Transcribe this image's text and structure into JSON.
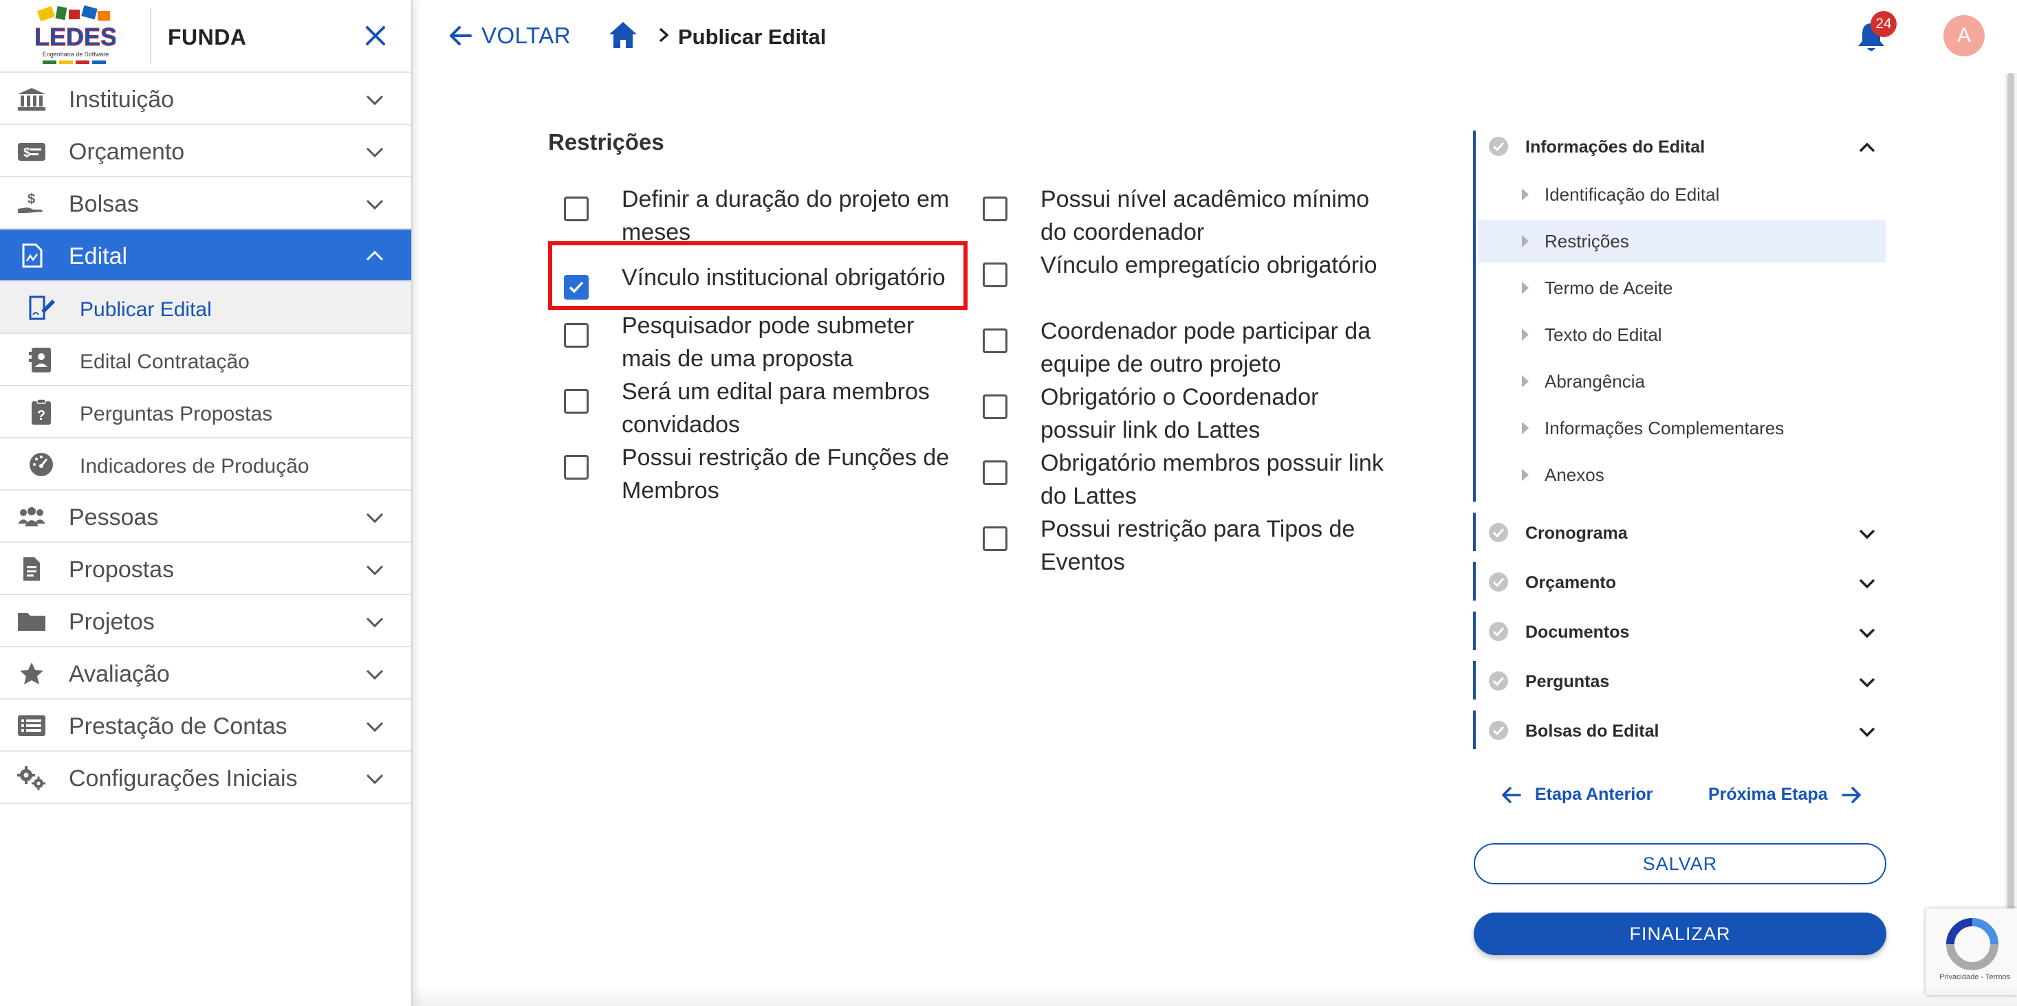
{
  "sidebar": {
    "app_name": "FUNDA",
    "logo_alt": "LEDES Engenharia de Software",
    "items": [
      {
        "label": "Instituição",
        "icon": "institution-icon",
        "expanded": false
      },
      {
        "label": "Orçamento",
        "icon": "money-icon",
        "expanded": false
      },
      {
        "label": "Bolsas",
        "icon": "hand-money-icon",
        "expanded": false
      },
      {
        "label": "Edital",
        "icon": "document-icon",
        "expanded": true
      },
      {
        "label": "Pessoas",
        "icon": "people-icon",
        "expanded": false
      },
      {
        "label": "Propostas",
        "icon": "file-icon",
        "expanded": false
      },
      {
        "label": "Projetos",
        "icon": "folder-icon",
        "expanded": false
      },
      {
        "label": "Avaliação",
        "icon": "star-icon",
        "expanded": false
      },
      {
        "label": "Prestação de Contas",
        "icon": "list-icon",
        "expanded": false
      },
      {
        "label": "Configurações Iniciais",
        "icon": "gears-icon",
        "expanded": false
      }
    ],
    "edital_subitems": [
      {
        "label": "Publicar Edital",
        "icon": "sign-document-icon",
        "selected": true
      },
      {
        "label": "Edital Contratação",
        "icon": "contact-card-icon",
        "selected": false
      },
      {
        "label": "Perguntas Propostas",
        "icon": "clipboard-question-icon",
        "selected": false
      },
      {
        "label": "Indicadores de Produção",
        "icon": "gauge-icon",
        "selected": false
      }
    ]
  },
  "topbar": {
    "back_label": "VOLTAR",
    "breadcrumb_current": "Publicar Edital",
    "notifications_count": "24",
    "avatar_initial": "A"
  },
  "main": {
    "section_title": "Restrições",
    "col1": [
      {
        "label": "Definir a duração do projeto em meses",
        "checked": false
      },
      {
        "label": "Vínculo institucional obrigatório",
        "checked": true
      },
      {
        "label": "Pesquisador pode submeter mais de uma proposta",
        "checked": false
      },
      {
        "label": "Será um edital para membros convidados",
        "checked": false
      },
      {
        "label": "Possui restrição de Funções de Membros",
        "checked": false
      }
    ],
    "col2": [
      {
        "label": "Possui nível acadêmico mínimo do coordenador",
        "checked": false
      },
      {
        "label": "Vínculo empregatício obrigatório",
        "checked": false
      },
      {
        "label": "Coordenador pode participar da equipe de outro projeto",
        "checked": false
      },
      {
        "label": "Obrigatório o Coordenador possuir link do Lattes",
        "checked": false
      },
      {
        "label": "Obrigatório membros possuir link do Lattes",
        "checked": false
      },
      {
        "label": "Possui restrição para Tipos de Eventos",
        "checked": false
      }
    ]
  },
  "stepper": {
    "first_step": {
      "label": "Informações do Edital",
      "expanded": true,
      "substeps": [
        "Identificação do Edital",
        "Restrições",
        "Termo de Aceite",
        "Texto do Edital",
        "Abrangência",
        "Informações Complementares",
        "Anexos"
      ],
      "current_substep": "Restrições"
    },
    "other_steps": [
      "Cronograma",
      "Orçamento",
      "Documentos",
      "Perguntas",
      "Bolsas do Edital"
    ],
    "prev_label": "Etapa Anterior",
    "next_label": "Próxima Etapa",
    "save_label": "SALVAR",
    "finish_label": "FINALIZAR"
  },
  "recaptcha": {
    "text": "Privacidade - Termos"
  },
  "colors": {
    "primary": "#1553b6",
    "active_menu": "#2a6fd8",
    "highlight": "#e81515",
    "badge": "#d32f2f",
    "avatar": "#f4a79b"
  }
}
